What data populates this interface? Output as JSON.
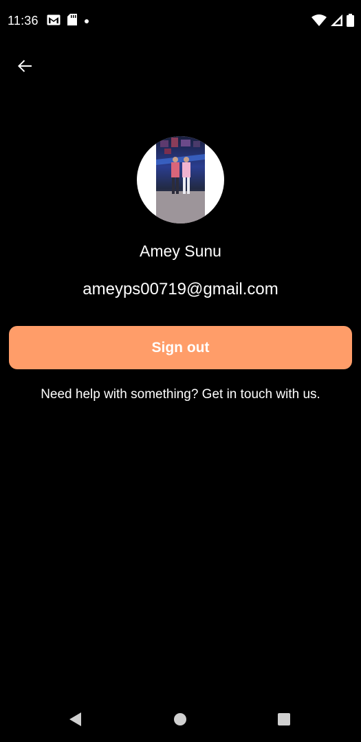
{
  "status_bar": {
    "time": "11:36",
    "left_icons": [
      "gmail-icon",
      "sd-card-icon",
      "dot-icon"
    ],
    "right_icons": [
      "wifi-icon",
      "signal-icon",
      "battery-icon"
    ]
  },
  "header": {
    "back_icon": "arrow-left-icon"
  },
  "profile": {
    "name": "Amey Sunu",
    "email": "ameyps00719@gmail.com"
  },
  "actions": {
    "sign_out_label": "Sign out",
    "help_text": "Need help with something? Get in touch with us."
  },
  "nav_bar": {
    "icons": [
      "back-triangle-icon",
      "home-circle-icon",
      "recents-square-icon"
    ]
  },
  "colors": {
    "background": "#000000",
    "accent": "#ff9d69",
    "text": "#ffffff"
  }
}
